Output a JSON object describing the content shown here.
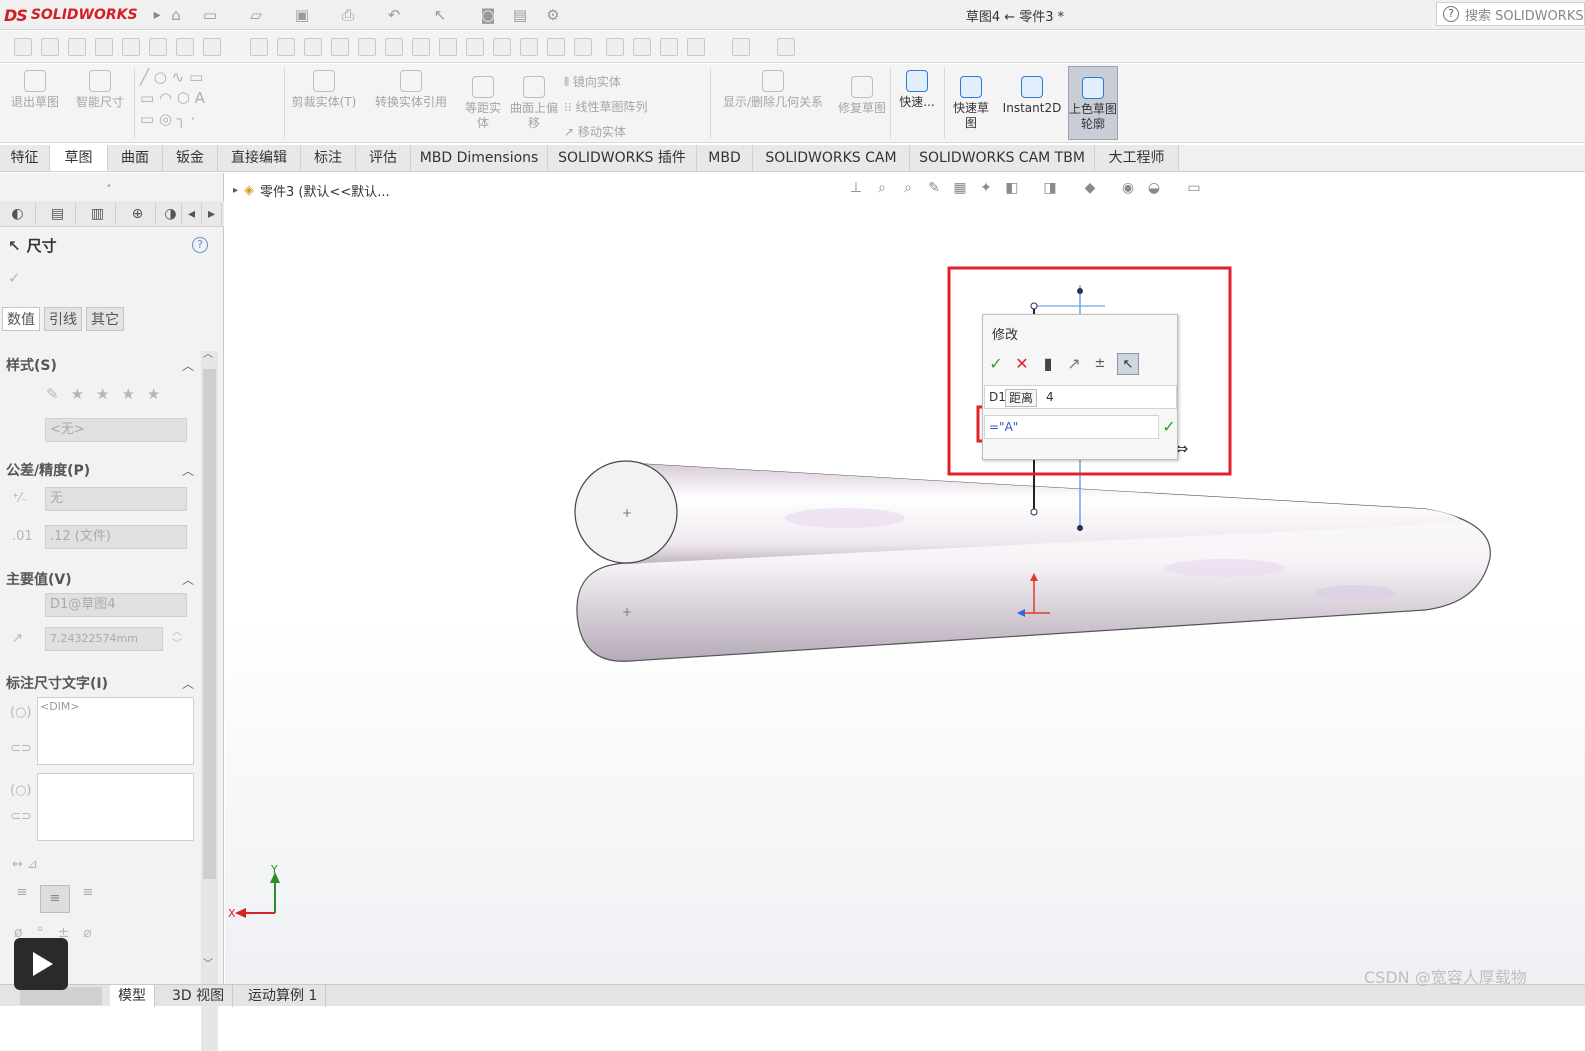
{
  "app": {
    "logo_ds": "DS",
    "logo_text": "SOLIDWORKS",
    "doc_title": "草图4 ← 零件3 *"
  },
  "search": {
    "label": "搜索 SOLIDWORKS"
  },
  "cmd": {
    "exit_sketch": "退出草图",
    "smart_dim": "智能尺寸",
    "trim": "剪裁实体(T)",
    "convert": "转换实体引用",
    "offset": "等距实体",
    "surface_offset": "曲面上偏移",
    "mirror": "镜向实体",
    "linear_pattern": "线性草图阵列",
    "move": "移动实体",
    "relations": "显示/删除几何关系",
    "repair": "修复草图",
    "quick_snaps": "快速...",
    "rapid_sketch": "快速草图",
    "instant2d": "Instant2D",
    "shaded": "上色草图轮廓"
  },
  "tabs": [
    "特征",
    "草图",
    "曲面",
    "钣金",
    "直接编辑",
    "标注",
    "评估",
    "MBD Dimensions",
    "SOLIDWORKS 插件",
    "MBD",
    "SOLIDWORKS CAM",
    "SOLIDWORKS CAM TBM",
    "大工程师"
  ],
  "panel": {
    "title": "尺寸",
    "subtabs": [
      "数值",
      "引线",
      "其它"
    ],
    "style_header": "样式(S)",
    "style_value": "<无>",
    "tolerance_header": "公差/精度(P)",
    "tolerance_value": "无",
    "precision_value": ".12 (文件)",
    "primary_header": "主要值(V)",
    "primary_name": "D1@草图4",
    "primary_value": "7.24322574mm",
    "dimtext_header": "标注尺寸文字(I)",
    "dimtext_value": "<DIM>"
  },
  "tree": {
    "item": "零件3 (默认<<默认..."
  },
  "modify": {
    "title": "修改",
    "name_prefix": "D1",
    "name_suffix": "4",
    "tooltip": "距离",
    "value": "=\"A\""
  },
  "triad": {
    "x": "X",
    "y": "Y"
  },
  "status_tabs": [
    "模型",
    "3D 视图",
    "运动算例 1"
  ],
  "watermark": "CSDN @宽容人厚载物",
  "colors": {
    "highlight": "#e0212b",
    "check": "#2e9d2e",
    "cross": "#d92626",
    "brand": "#d21f24"
  }
}
